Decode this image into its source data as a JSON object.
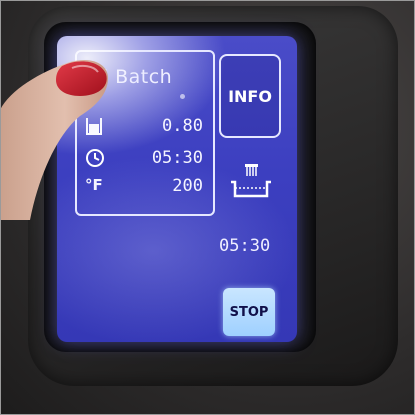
{
  "program": {
    "title": "ll Batch",
    "quantity": "0.80",
    "time": "05:30",
    "temp_unit": "°F",
    "temperature": "200"
  },
  "buttons": {
    "info_label": "INFO",
    "stop_label": "STOP"
  },
  "status": {
    "remaining_time": "05:30"
  },
  "icons": {
    "quantity": "container-icon",
    "time": "clock-icon",
    "basket": "fry-basket-icon"
  },
  "colors": {
    "screen": "#3c3fc0",
    "stop_button": "#a8d6ff",
    "nail_polish": "#c21a2a"
  }
}
